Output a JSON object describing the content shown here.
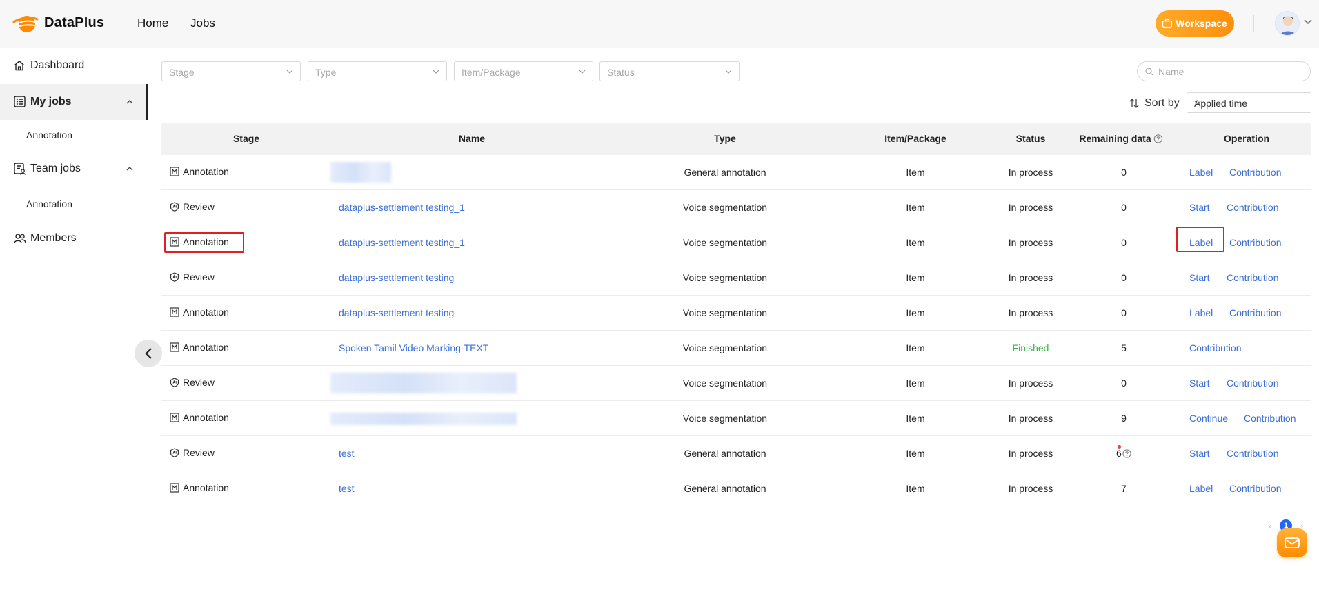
{
  "app": {
    "name": "DataPlus",
    "workspace_label": "Workspace"
  },
  "topnav": {
    "home": "Home",
    "jobs": "Jobs"
  },
  "sidebar": {
    "dashboard": "Dashboard",
    "my_jobs": "My jobs",
    "my_jobs_sub": "Annotation",
    "team_jobs": "Team jobs",
    "team_jobs_sub": "Annotation",
    "members": "Members"
  },
  "filters": {
    "stage": "Stage",
    "type": "Type",
    "item_package": "Item/Package",
    "status": "Status",
    "search_placeholder": "Name"
  },
  "sort": {
    "label": "Sort by",
    "value": "Applied time"
  },
  "table": {
    "headers": {
      "stage": "Stage",
      "name": "Name",
      "type": "Type",
      "item_package": "Item/Package",
      "status": "Status",
      "remaining": "Remaining data",
      "operation": "Operation"
    },
    "rows": [
      {
        "stage": "Annotation",
        "name": "",
        "type": "General annotation",
        "item": "Item",
        "status": "In process",
        "remaining": "0",
        "op1": "Label",
        "op2": "Contribution"
      },
      {
        "stage": "Review",
        "name": "dataplus-settlement testing_1",
        "type": "Voice segmentation",
        "item": "Item",
        "status": "In process",
        "remaining": "0",
        "op1": "Start",
        "op2": "Contribution"
      },
      {
        "stage": "Annotation",
        "name": "dataplus-settlement testing_1",
        "type": "Voice segmentation",
        "item": "Item",
        "status": "In process",
        "remaining": "0",
        "op1": "Label",
        "op2": "Contribution"
      },
      {
        "stage": "Review",
        "name": "dataplus-settlement testing",
        "type": "Voice segmentation",
        "item": "Item",
        "status": "In process",
        "remaining": "0",
        "op1": "Start",
        "op2": "Contribution"
      },
      {
        "stage": "Annotation",
        "name": "dataplus-settlement testing",
        "type": "Voice segmentation",
        "item": "Item",
        "status": "In process",
        "remaining": "0",
        "op1": "Label",
        "op2": "Contribution"
      },
      {
        "stage": "Annotation",
        "name": "Spoken Tamil Video Marking-TEXT",
        "type": "Voice segmentation",
        "item": "Item",
        "status": "Finished",
        "remaining": "5",
        "op1": "Contribution",
        "op2": ""
      },
      {
        "stage": "Review",
        "name": "",
        "type": "Voice segmentation",
        "item": "Item",
        "status": "In process",
        "remaining": "0",
        "op1": "Start",
        "op2": "Contribution"
      },
      {
        "stage": "Annotation",
        "name": "",
        "type": "Voice segmentation",
        "item": "Item",
        "status": "In process",
        "remaining": "9",
        "op1": "Continue",
        "op2": "Contribution"
      },
      {
        "stage": "Review",
        "name": "test",
        "type": "General annotation",
        "item": "Item",
        "status": "In process",
        "remaining": "6",
        "op1": "Start",
        "op2": "Contribution"
      },
      {
        "stage": "Annotation",
        "name": "test",
        "type": "General annotation",
        "item": "Item",
        "status": "In process",
        "remaining": "7",
        "op1": "Label",
        "op2": "Contribution"
      }
    ]
  },
  "pagination": {
    "current": "1",
    "prev": "‹",
    "next": "›"
  },
  "colors": {
    "accent": "#ff9a1a",
    "link": "#3a6fd8",
    "finished": "#3bb34a",
    "highlight": "#e02020"
  }
}
